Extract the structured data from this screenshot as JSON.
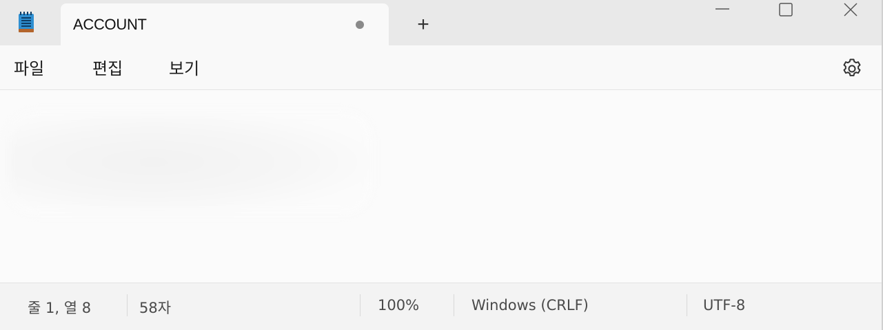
{
  "tab": {
    "title": "ACCOUNT",
    "unsaved_indicator": "dot-icon",
    "new_tab_label": "+"
  },
  "window_controls": {
    "minimize_icon": "minimize-icon",
    "maximize_icon": "maximize-icon",
    "close_icon": "close-icon"
  },
  "menu": {
    "file": "파일",
    "edit": "편집",
    "view": "보기",
    "settings_icon": "gear-icon"
  },
  "editor": {
    "content": ""
  },
  "status": {
    "position": "줄 1, 열 8",
    "char_count": "58자",
    "zoom": "100%",
    "line_ending": "Windows (CRLF)",
    "encoding": "UTF-8"
  },
  "colors": {
    "titlebar_bg": "#e9e9e9",
    "tab_bg": "#f9f9f9",
    "app_icon_blue": "#2f8fd1",
    "status_text": "#4a4a4a"
  }
}
